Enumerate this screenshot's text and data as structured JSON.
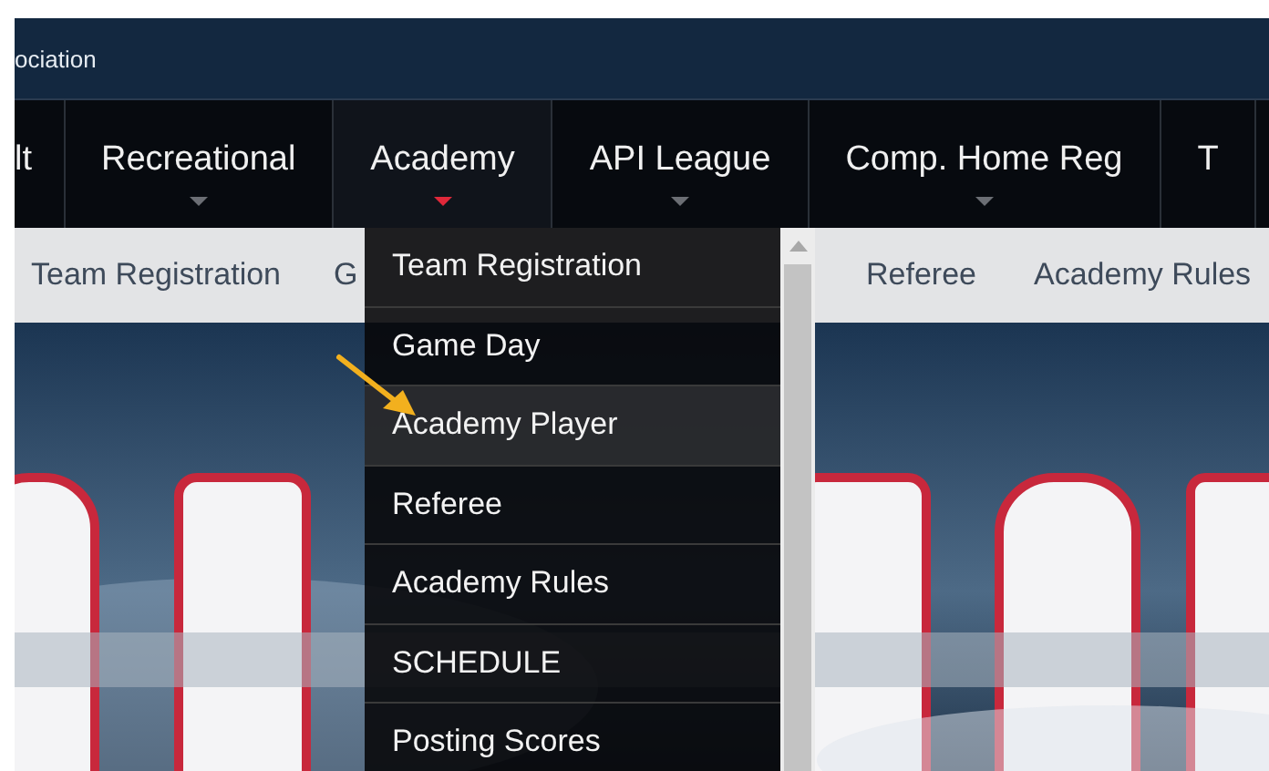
{
  "header": {
    "title": "ociation"
  },
  "nav": [
    {
      "label": "lt",
      "selected": false,
      "has_menu": false
    },
    {
      "label": "Recreational",
      "selected": false,
      "has_menu": true
    },
    {
      "label": "Academy",
      "selected": true,
      "has_menu": true
    },
    {
      "label": "API League",
      "selected": false,
      "has_menu": true
    },
    {
      "label": "Comp. Home Reg",
      "selected": false,
      "has_menu": true
    },
    {
      "label": "T",
      "selected": false,
      "has_menu": false
    }
  ],
  "subnav": [
    {
      "label": "Team Registration"
    },
    {
      "label": "G"
    },
    {
      "label": "Referee"
    },
    {
      "label": "Academy Rules"
    }
  ],
  "dropdown": {
    "items": [
      {
        "label": "Team Registration",
        "selected": false
      },
      {
        "label": "Game Day",
        "selected": false
      },
      {
        "label": "Academy Player",
        "selected": true
      },
      {
        "label": "Referee",
        "selected": false
      },
      {
        "label": "Academy Rules",
        "selected": false
      },
      {
        "label": "SCHEDULE",
        "selected": false
      },
      {
        "label": "Posting Scores",
        "selected": false
      }
    ]
  }
}
